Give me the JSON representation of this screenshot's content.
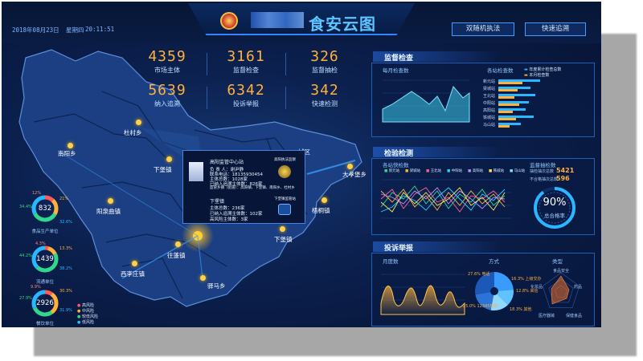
{
  "header": {
    "date": "2018年08月23日",
    "weekday": "星期四",
    "time": "20:11:51",
    "title": "食安云图",
    "buttons": [
      "双随机执法",
      "快速追溯"
    ]
  },
  "stats": [
    {
      "value": "4359",
      "label": "市场主体"
    },
    {
      "value": "3161",
      "label": "监督检查"
    },
    {
      "value": "326",
      "label": "监督抽检"
    },
    {
      "value": "5639",
      "label": "纳入追溯"
    },
    {
      "value": "6342",
      "label": "投诉举报"
    },
    {
      "value": "342",
      "label": "快速检测"
    }
  ],
  "map": {
    "towns": [
      "杜村乡",
      "南阳乡",
      "下堡镇",
      "阳泉曲镇",
      "往蓬镇",
      "西李庄镇",
      "驿马乡",
      "下堡镇",
      "梧桐镇",
      "大孝堡乡",
      "城区"
    ],
    "popup": {
      "station": "高阳监管中心站",
      "lines": [
        "负 责 人：谢尹静",
        "联系电话：18135930454",
        "主体总数：1028家",
        "已纳入追溯主体数：826家",
        "监管乡镇（街道）：高阳镇、下堡镇、南阳乡、杜村乡"
      ],
      "town": "下堡镇",
      "town_lines": [
        "主体总数：236家",
        "已纳入追溯主体数：102家",
        "高风险主体数：3家"
      ],
      "badge1": "高阳执法监察",
      "badge2": "下堡镇监管站"
    }
  },
  "donuts": [
    {
      "value": "832",
      "label": "食品生产单位",
      "pcts": [
        "12%",
        "21%",
        "34.4%",
        "32.6%"
      ]
    },
    {
      "value": "1439",
      "label": "流通单位",
      "pcts": [
        "4.3%",
        "13.3%",
        "44.2%",
        "38.2%"
      ]
    },
    {
      "value": "2926",
      "label": "餐饮单位",
      "pcts": [
        "9.9%",
        "30.3%",
        "27.9%",
        "31.9%"
      ]
    }
  ],
  "donut_legend": [
    "高风险",
    "中风险",
    "较低风险",
    "低风险"
  ],
  "panels": {
    "supervision": {
      "title": "监督检查",
      "left_sub": "每月检查数",
      "right_sub": "各站检查数",
      "legend": [
        "年度累计检查总数",
        "本月检查数"
      ],
      "stations": [
        "新元站",
        "梁城站",
        "王北站",
        "中阳站",
        "高阳站",
        "铁城站",
        "马山站"
      ]
    },
    "inspection": {
      "title": "检验检测",
      "left_sub": "各站快检数",
      "right_sub": "监督抽检数",
      "series_names": [
        "新元站",
        "梁城站",
        "王北站",
        "中阳站",
        "高阳站",
        "铁城站",
        "马山站"
      ],
      "stat_lines": [
        {
          "label": "抽检抽次总数",
          "value": "5421"
        },
        {
          "label": "不合格抽次总数",
          "value": "596"
        }
      ],
      "gauge_value": "90%",
      "gauge_label": "总合格率"
    },
    "complaints": {
      "title": "投诉举报",
      "left_sub": "月度数",
      "mid_sub": "方式",
      "right_sub": "类型",
      "pie_labels": [
        {
          "pct": "27.6%",
          "name": "电话"
        },
        {
          "pct": "16.3%",
          "name": "上级交办"
        },
        {
          "pct": "12.8%",
          "name": "来信"
        },
        {
          "pct": "18.3%",
          "name": "其他"
        },
        {
          "pct": "25.0%",
          "name": "12345热线"
        }
      ],
      "radar_labels": [
        "食品安全",
        "药品",
        "保健食品",
        "医疗器械",
        "化妆品"
      ]
    }
  },
  "colors": {
    "accent": "#ffb13b",
    "cyan": "#29d2ff",
    "panel_border": "#1e5fb8"
  }
}
